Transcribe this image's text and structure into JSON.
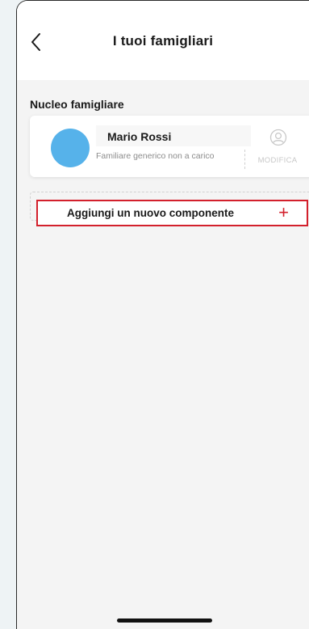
{
  "header": {
    "title": "I tuoi famigliari",
    "back_icon": "chevron-left-icon"
  },
  "section": {
    "title": "Nucleo famigliare"
  },
  "member": {
    "name": "Mario Rossi",
    "subtitle": "Familiare generico non a carico",
    "avatar_color": "#56b2ea",
    "edit_label": "MODIFICA",
    "edit_icon": "user-circle-icon"
  },
  "add_member": {
    "label": "Aggiungi un nuovo componente",
    "plus": "+",
    "accent_color": "#d3202c"
  }
}
